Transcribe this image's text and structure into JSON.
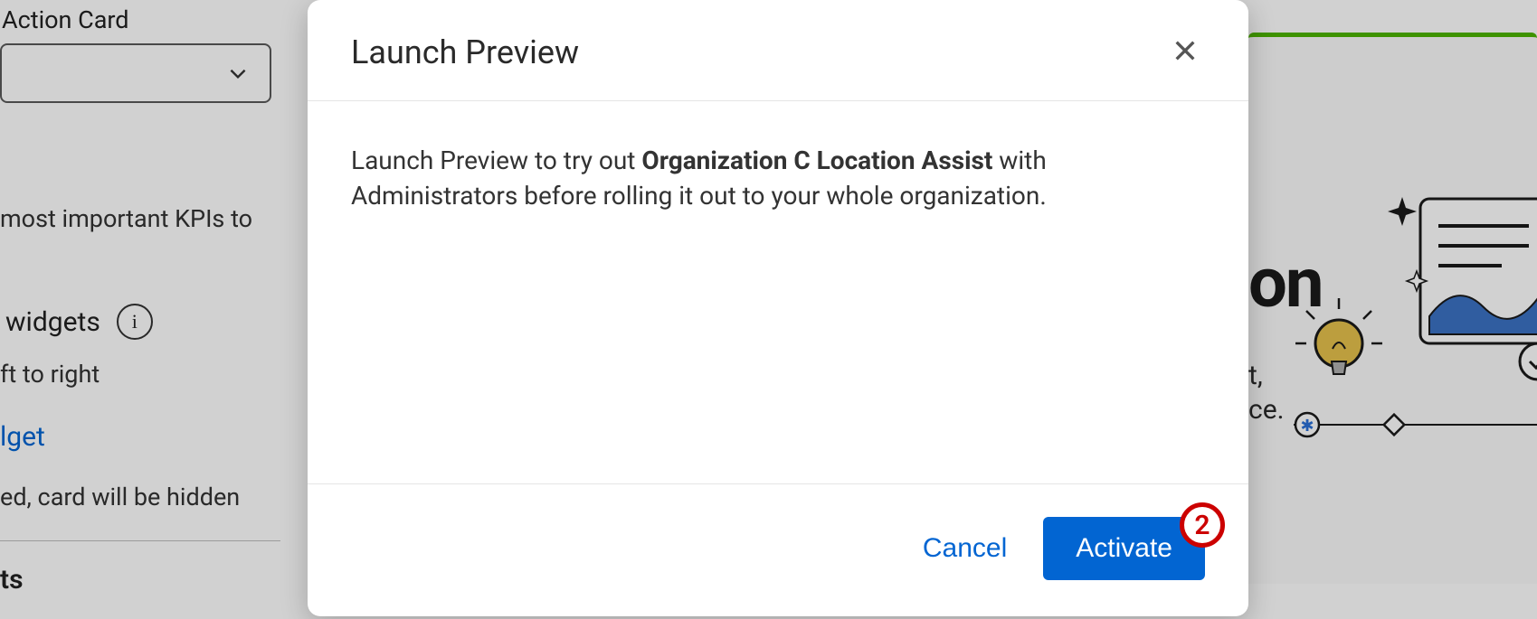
{
  "background": {
    "action_card_label": "Action Card",
    "kpi_text": "most important KPIs to",
    "widgets_label": "widgets",
    "info_icon": "info-icon",
    "ltr_text": "ft to right",
    "link_text": "lget",
    "hidden_text": "ed, card will be hidden",
    "ts_label": "ts",
    "right_fragment_on": "on",
    "right_fragment_t": "t,",
    "right_fragment_ce": "ce."
  },
  "modal": {
    "title": "Launch Preview",
    "body_prefix": "Launch Preview to try out ",
    "body_bold": "Organization C Location Assist",
    "body_suffix": " with Administrators before rolling it out to your whole organization.",
    "cancel_label": "Cancel",
    "activate_label": "Activate",
    "step_badge": "2"
  }
}
